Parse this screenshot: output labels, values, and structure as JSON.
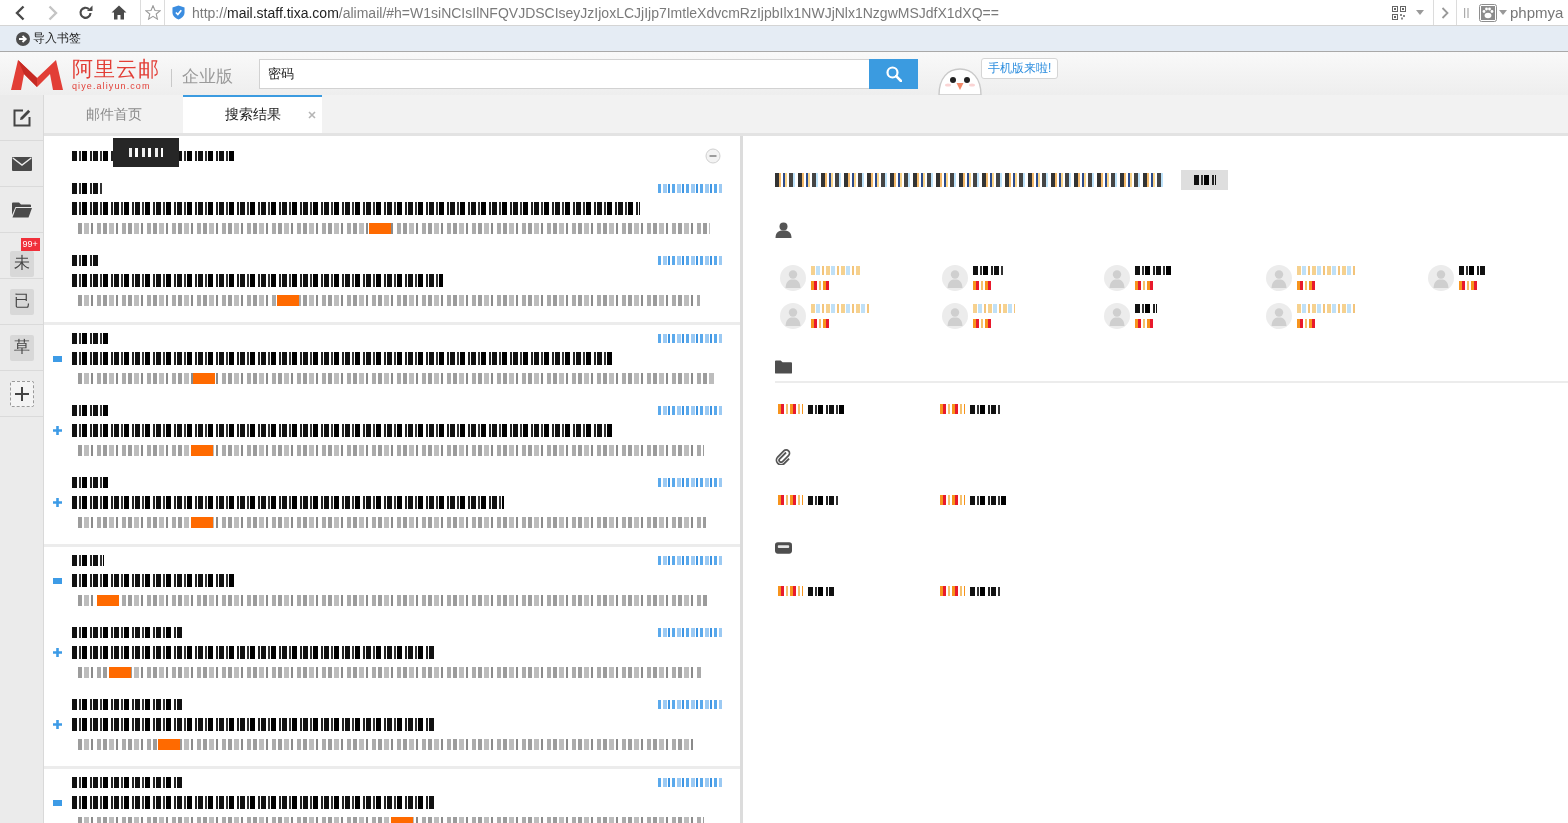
{
  "browser": {
    "nav": [
      {
        "kind": "back",
        "disabled": false
      },
      {
        "kind": "forward",
        "disabled": true
      },
      {
        "kind": "reload",
        "disabled": false
      },
      {
        "kind": "home",
        "disabled": false
      }
    ],
    "address": {
      "scheme": "http://",
      "host": "mail.staff.tixa.com",
      "rest": "/alimail/#h=W1siNCIsIlNFQVJDSCIseyJzIjoxLCJjIjp7ImtleXdvcmRzIjpbIlx1NWJjNlx1NzgwMSJdfX1dXQ=="
    },
    "extension": {
      "label": "phpmya"
    }
  },
  "bookmarks_bar": {
    "items": [
      {
        "label": "导入书签"
      }
    ]
  },
  "header": {
    "brand": "阿里云邮",
    "domain": "qiye.aliyun.com",
    "edition": "企业版",
    "search": {
      "value": "密码"
    },
    "promo": "手机版来啦!"
  },
  "rail": [
    {
      "kind": "compose"
    },
    {
      "kind": "mail"
    },
    {
      "kind": "folders"
    },
    {
      "kind": "filter",
      "label": "未",
      "badge": "99+"
    },
    {
      "kind": "filter",
      "label": "已"
    },
    {
      "kind": "filter",
      "label": "草"
    },
    {
      "kind": "add"
    }
  ],
  "tabs": [
    {
      "label": "邮件首页",
      "selected": false,
      "closable": false
    },
    {
      "label": "搜索结果",
      "selected": true,
      "closable": true
    }
  ],
  "results": {
    "heading": {
      "redacted": true,
      "tooltip": {
        "redacted": true
      }
    },
    "groups": [
      {
        "messages": [
          {
            "kind": "plain",
            "redacted": true
          },
          {
            "kind": "plain",
            "redacted": true
          }
        ]
      },
      {
        "messages": [
          {
            "kind": "square",
            "redacted": true
          },
          {
            "kind": "plus",
            "redacted": true
          },
          {
            "kind": "plus",
            "redacted": true
          }
        ]
      },
      {
        "messages": [
          {
            "kind": "square",
            "redacted": true
          },
          {
            "kind": "plus",
            "redacted": true
          },
          {
            "kind": "plus",
            "redacted": true
          }
        ]
      },
      {
        "messages": [
          {
            "kind": "square",
            "redacted": true
          }
        ]
      }
    ]
  },
  "overview": {
    "summary": {
      "redacted": true,
      "button": {
        "redacted": true
      }
    },
    "sections": [
      {
        "kind": "contacts",
        "items": [
          {
            "redacted": true
          },
          {
            "redacted": true
          },
          {
            "redacted": true
          },
          {
            "redacted": true
          },
          {
            "redacted": true
          },
          {
            "redacted": true
          },
          {
            "redacted": true
          },
          {
            "redacted": true
          },
          {
            "redacted": true
          }
        ]
      },
      {
        "kind": "folders",
        "items": [
          {
            "redacted": true
          },
          {
            "redacted": true
          }
        ]
      },
      {
        "kind": "attachments",
        "items": [
          {
            "redacted": true
          },
          {
            "redacted": true
          }
        ]
      },
      {
        "kind": "tray",
        "items": [
          {
            "redacted": true
          },
          {
            "redacted": true
          }
        ]
      }
    ]
  }
}
